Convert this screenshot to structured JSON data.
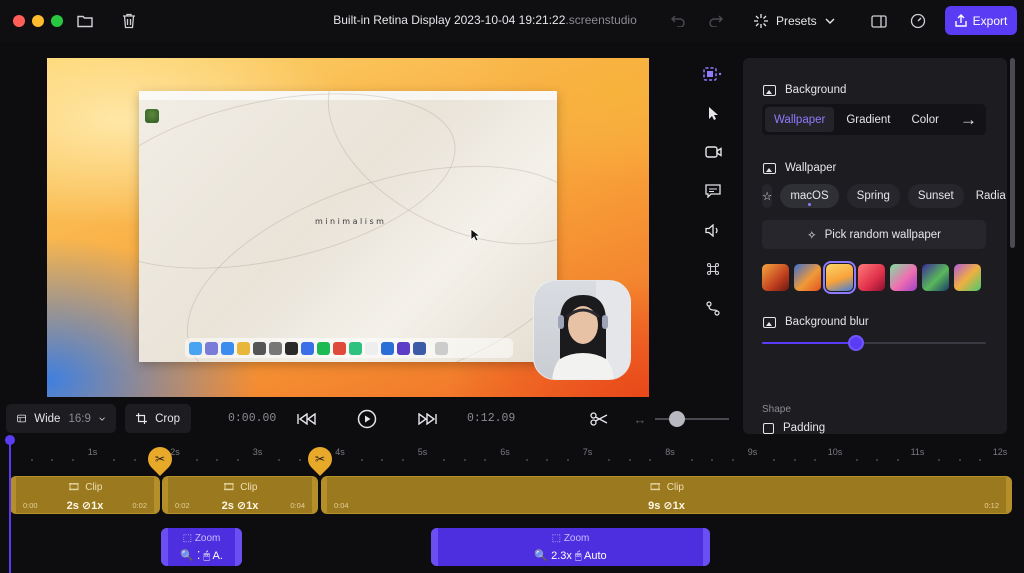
{
  "window": {
    "title_main": "Built-in Retina Display 2023-10-04 19:21:22",
    "title_ext": ".screenstudio",
    "presets_label": "Presets",
    "export_label": "Export"
  },
  "preview": {
    "wallpaper_text": "minimalism"
  },
  "panel": {
    "background_title": "Background",
    "tabs": [
      "Wallpaper",
      "Gradient",
      "Color"
    ],
    "active_tab": "Wallpaper",
    "wallpaper_title": "Wallpaper",
    "categories": [
      "macOS",
      "Spring",
      "Sunset",
      "Radia"
    ],
    "active_category": "macOS",
    "pick_random_label": "Pick random wallpaper",
    "blur_title": "Background blur",
    "blur_value": 0.42,
    "shape_label": "Shape",
    "padding_title": "Padding"
  },
  "controls": {
    "aspect_label": "Wide",
    "aspect_ratio": "16:9",
    "crop_label": "Crop",
    "current_time": "0:00.00",
    "total_time": "0:12.09"
  },
  "timeline": {
    "ticks": [
      "1s",
      "2s",
      "3s",
      "4s",
      "5s",
      "6s",
      "7s",
      "8s",
      "9s",
      "10s",
      "11s",
      "12s"
    ],
    "clips": [
      {
        "label": "Clip",
        "duration": "2s",
        "speed": "1x",
        "start": "0:00",
        "end": "0:02"
      },
      {
        "label": "Clip",
        "duration": "2s",
        "speed": "1x",
        "start": "0:02",
        "end": "0:04"
      },
      {
        "label": "Clip",
        "duration": "9s",
        "speed": "1x",
        "start": "0:04",
        "end": "0:12"
      }
    ],
    "zooms": [
      {
        "label": "Zoom",
        "detail": "🔍 ⁚ 🖱 A."
      },
      {
        "label": "Zoom",
        "detail": "🔍 2.3x  🖱 Auto"
      }
    ]
  }
}
